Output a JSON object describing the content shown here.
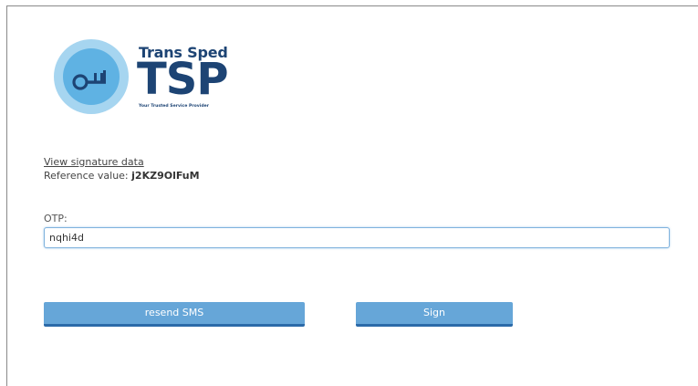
{
  "logo": {
    "title": "Trans Sped",
    "acronym": "TSP",
    "tagline": "Your Trusted Service Provider",
    "icon": "key-cloud-icon",
    "colors": {
      "circle_outer": "#a6d5f0",
      "circle_inner": "#5fb2e3",
      "brand_navy": "#1d4474"
    }
  },
  "signature": {
    "view_link": "View signature data",
    "reference_label": "Reference value:",
    "reference_value": "j2KZ9OlFuM"
  },
  "otp": {
    "label": "OTP:",
    "value": "nqhi4d"
  },
  "actions": {
    "resend_label": "resend SMS",
    "sign_label": "Sign"
  },
  "colors": {
    "button_bg": "#66a6d8",
    "button_border": "#2b6aa8",
    "input_border": "#7fb2dd"
  }
}
